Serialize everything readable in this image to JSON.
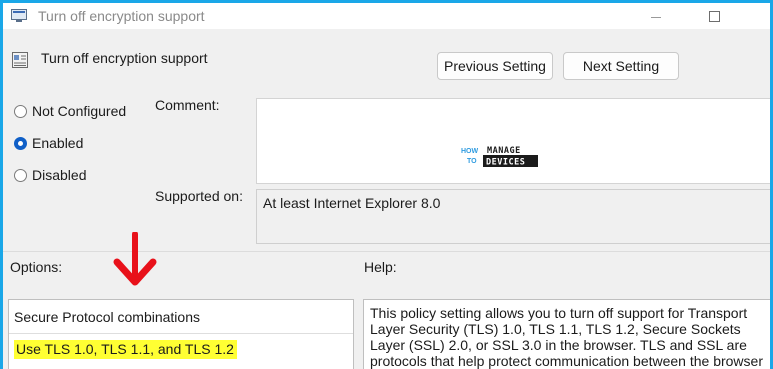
{
  "window": {
    "title": "Turn off encryption support",
    "icon": "policy-setting-icon"
  },
  "header": {
    "title": "Turn off encryption support",
    "icon": "policy-setting-icon"
  },
  "nav": {
    "previous_label": "Previous Setting",
    "next_label": "Next Setting"
  },
  "state": {
    "options": [
      {
        "label": "Not Configured",
        "selected": false
      },
      {
        "label": "Enabled",
        "selected": true
      },
      {
        "label": "Disabled",
        "selected": false
      }
    ]
  },
  "comment": {
    "label": "Comment:",
    "value": ""
  },
  "supported": {
    "label": "Supported on:",
    "value": "At least Internet Explorer 8.0"
  },
  "watermark": {
    "line1": "HOW TO",
    "line2": "MANAGE",
    "line3": "DEVICES"
  },
  "options_section": {
    "label": "Options:",
    "field_label": "Secure Protocol combinations",
    "selected_value": "Use TLS 1.0, TLS 1.1, and TLS 1.2"
  },
  "help_section": {
    "label": "Help:",
    "text": "This policy setting allows you to turn off support for Transport Layer Security (TLS) 1.0, TLS 1.1, TLS 1.2, Secure Sockets Layer (SSL) 2.0, or SSL 3.0 in the browser. TLS and SSL are protocols that help protect communication between the browser and the target"
  },
  "annotation": {
    "arrow_color": "#e8111a",
    "highlight_color": "#ffff33"
  }
}
